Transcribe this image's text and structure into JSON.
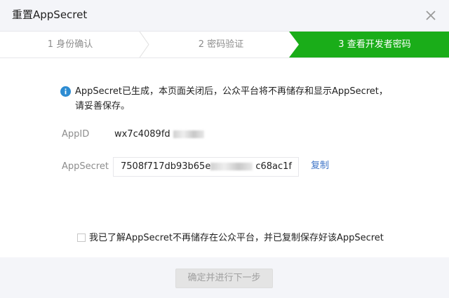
{
  "dialog": {
    "title": "重置AppSecret",
    "close_icon": "close-icon"
  },
  "steps": [
    {
      "label": "1 身份确认",
      "state": "done"
    },
    {
      "label": "2 密码验证",
      "state": "done"
    },
    {
      "label": "3 查看开发者密码",
      "state": "active"
    }
  ],
  "colors": {
    "accent_green": "#1aad19",
    "link_blue": "#3e74c7",
    "info_blue": "#2d8cd2",
    "header_bg": "#f4f5f9"
  },
  "notice": {
    "icon": "info-icon",
    "text": "AppSecret已生成，本页面关闭后，公众平台将不再储存和显示AppSecret，请妥善保存。"
  },
  "fields": {
    "appid": {
      "label": "AppID",
      "value_visible": "wx7c4089fd"
    },
    "appsecret": {
      "label": "AppSecret",
      "value_prefix": "7508f717db93b65e",
      "value_suffix": "c68ac1f",
      "copy_label": "复制"
    }
  },
  "agree": {
    "label": "我已了解AppSecret不再储存在公众平台，并已复制保存好该AppSecret"
  },
  "footer": {
    "next_label": "确定并进行下一步"
  }
}
